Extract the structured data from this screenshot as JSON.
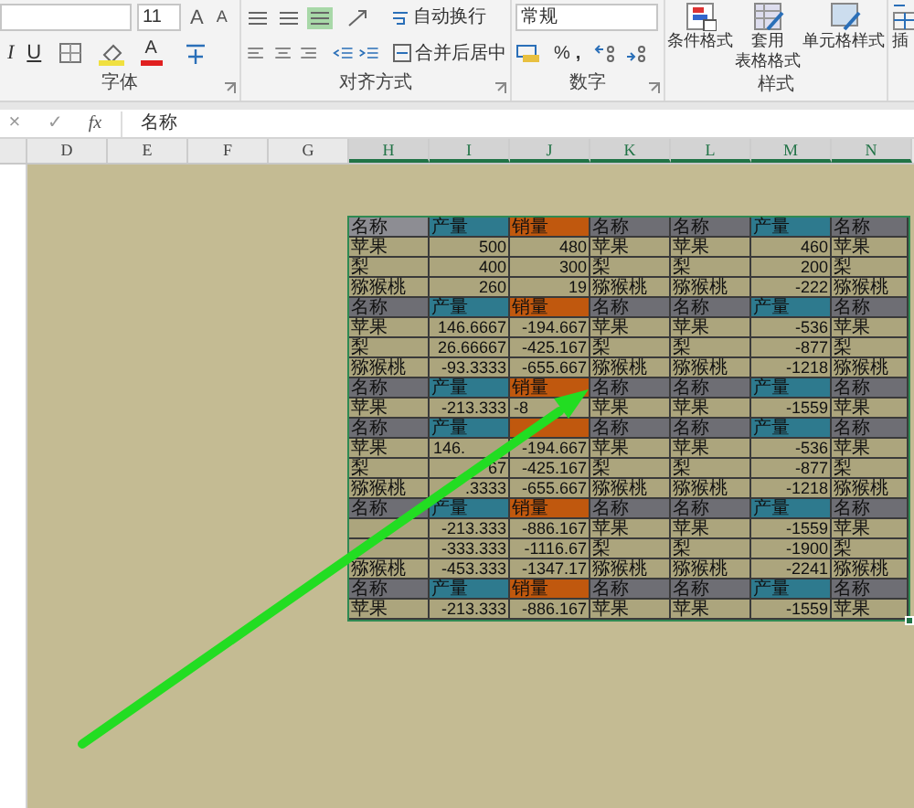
{
  "ribbon": {
    "font_size": "11",
    "grow_font": "A",
    "shrink_font": "A",
    "italic": "I",
    "underline": "U",
    "font_color": "A",
    "wrap_text": "自动换行",
    "merge_center": "合并后居中",
    "number_format": "常规",
    "percent": "%",
    "comma": ",",
    "styles": [
      {
        "label_lines": [
          "条件格式"
        ]
      },
      {
        "label_lines": [
          "套用",
          "表格格式"
        ]
      },
      {
        "label_lines": [
          "单元格样式"
        ]
      }
    ],
    "insert": "插",
    "groups": [
      {
        "label": "字体"
      },
      {
        "label": "对齐方式"
      },
      {
        "label": "数字"
      },
      {
        "label": "样式"
      }
    ]
  },
  "formula_bar": {
    "cancel": "×",
    "enter": "✓",
    "function": "fx",
    "value": "名称"
  },
  "columns": [
    {
      "label": "D",
      "selected": false
    },
    {
      "label": "E",
      "selected": false
    },
    {
      "label": "F",
      "selected": false
    },
    {
      "label": "G",
      "selected": false
    },
    {
      "label": "H",
      "selected": true
    },
    {
      "label": "I",
      "selected": true
    },
    {
      "label": "J",
      "selected": true
    },
    {
      "label": "K",
      "selected": true
    },
    {
      "label": "L",
      "selected": true
    },
    {
      "label": "M",
      "selected": true
    },
    {
      "label": "N",
      "selected": true
    }
  ],
  "table": {
    "rows": [
      {
        "kind": "header",
        "cells": [
          {
            "text": "名称",
            "color": "#8d8d93"
          },
          {
            "text": "产量",
            "color": "#2e7a8e"
          },
          {
            "text": "销量",
            "color": "#c0580e"
          },
          {
            "text": "名称",
            "color": "#6e6e74"
          },
          {
            "text": "名称",
            "color": "#6e6e74"
          },
          {
            "text": "产量",
            "color": "#2e7a8e"
          },
          {
            "text": "名称",
            "color": "#6e6e74"
          }
        ]
      },
      {
        "kind": "data",
        "cells": [
          "苹果",
          "500",
          "480",
          "苹果",
          "苹果",
          "460",
          "苹果"
        ]
      },
      {
        "kind": "data",
        "cells": [
          "梨",
          "400",
          "300",
          "梨",
          "梨",
          "200",
          "梨"
        ]
      },
      {
        "kind": "data",
        "cells": [
          "猕猴桃",
          "260",
          "19",
          "猕猴桃",
          "猕猴桃",
          "-222",
          "猕猴桃"
        ]
      },
      {
        "kind": "header",
        "cells": [
          {
            "text": "名称",
            "color": "#6e6e74"
          },
          {
            "text": "产量",
            "color": "#2e7a8e"
          },
          {
            "text": "销量",
            "color": "#c0580e"
          },
          {
            "text": "名称",
            "color": "#6e6e74"
          },
          {
            "text": "名称",
            "color": "#6e6e74"
          },
          {
            "text": "产量",
            "color": "#2e7a8e"
          },
          {
            "text": "名称",
            "color": "#6e6e74"
          }
        ]
      },
      {
        "kind": "data",
        "cells": [
          "苹果",
          "146.6667",
          "-194.667",
          "苹果",
          "苹果",
          "-536",
          "苹果"
        ]
      },
      {
        "kind": "data",
        "cells": [
          "梨",
          "26.66667",
          "-425.167",
          "梨",
          "梨",
          "-877",
          "梨"
        ]
      },
      {
        "kind": "data",
        "cells": [
          "猕猴桃",
          "-93.3333",
          "-655.667",
          "猕猴桃",
          "猕猴桃",
          "-1218",
          "猕猴桃"
        ]
      },
      {
        "kind": "header",
        "cells": [
          {
            "text": "名称",
            "color": "#6e6e74"
          },
          {
            "text": "产量",
            "color": "#2e7a8e"
          },
          {
            "text": "销量",
            "color": "#c0580e"
          },
          {
            "text": "名称",
            "color": "#6e6e74"
          },
          {
            "text": "名称",
            "color": "#6e6e74"
          },
          {
            "text": "产量",
            "color": "#2e7a8e"
          },
          {
            "text": "名称",
            "color": "#6e6e74"
          }
        ]
      },
      {
        "kind": "data",
        "cells": [
          "苹果",
          "-213.333",
          {
            "text": "-8",
            "covered": true
          },
          "苹果",
          "苹果",
          "-1559",
          "苹果"
        ]
      },
      {
        "kind": "header",
        "cells": [
          {
            "text": "名称",
            "color": "#6e6e74"
          },
          {
            "text": "产量",
            "color": "#2e7a8e"
          },
          {
            "color": "#c0580e"
          },
          {
            "text": "名称",
            "color": "#6e6e74"
          },
          {
            "text": "名称",
            "color": "#6e6e74"
          },
          {
            "text": "产量",
            "color": "#2e7a8e"
          },
          {
            "text": "名称",
            "color": "#6e6e74"
          }
        ]
      },
      {
        "kind": "data",
        "cells": [
          "苹果",
          {
            "text": "146.",
            "covered": true
          },
          "-194.667",
          "苹果",
          "苹果",
          "-536",
          "苹果"
        ]
      },
      {
        "kind": "data",
        "cells": [
          "梨",
          "67",
          "-425.167",
          "梨",
          "梨",
          "-877",
          "梨"
        ]
      },
      {
        "kind": "data",
        "cells": [
          "猕猴桃",
          ".3333",
          "-655.667",
          "猕猴桃",
          "猕猴桃",
          "-1218",
          "猕猴桃"
        ]
      },
      {
        "kind": "header",
        "cells": [
          {
            "text": "名称",
            "color": "#6e6e74"
          },
          {
            "text": "产量",
            "color": "#2e7a8e"
          },
          {
            "text": "销量",
            "color": "#c0580e"
          },
          {
            "text": "名称",
            "color": "#6e6e74"
          },
          {
            "text": "名称",
            "color": "#6e6e74"
          },
          {
            "text": "产量",
            "color": "#2e7a8e"
          },
          {
            "text": "名称",
            "color": "#6e6e74"
          }
        ]
      },
      {
        "kind": "data",
        "cells": [
          null,
          "-213.333",
          "-886.167",
          "苹果",
          "苹果",
          "-1559",
          "苹果"
        ]
      },
      {
        "kind": "data",
        "cells": [
          null,
          "-333.333",
          "-1116.67",
          "梨",
          "梨",
          "-1900",
          "梨"
        ]
      },
      {
        "kind": "data",
        "cells": [
          "猕猴桃",
          "-453.333",
          "-1347.17",
          "猕猴桃",
          "猕猴桃",
          "-2241",
          "猕猴桃"
        ]
      },
      {
        "kind": "header",
        "cells": [
          {
            "text": "名称",
            "color": "#6e6e74"
          },
          {
            "text": "产量",
            "color": "#2e7a8e"
          },
          {
            "text": "销量",
            "color": "#c0580e"
          },
          {
            "text": "名称",
            "color": "#6e6e74"
          },
          {
            "text": "名称",
            "color": "#6e6e74"
          },
          {
            "text": "产量",
            "color": "#2e7a8e"
          },
          {
            "text": "名称",
            "color": "#6e6e74"
          }
        ]
      },
      {
        "kind": "data",
        "cells": [
          "苹果",
          "-213.333",
          "-886.167",
          "苹果",
          "苹果",
          "-1559",
          "苹果"
        ]
      }
    ]
  }
}
